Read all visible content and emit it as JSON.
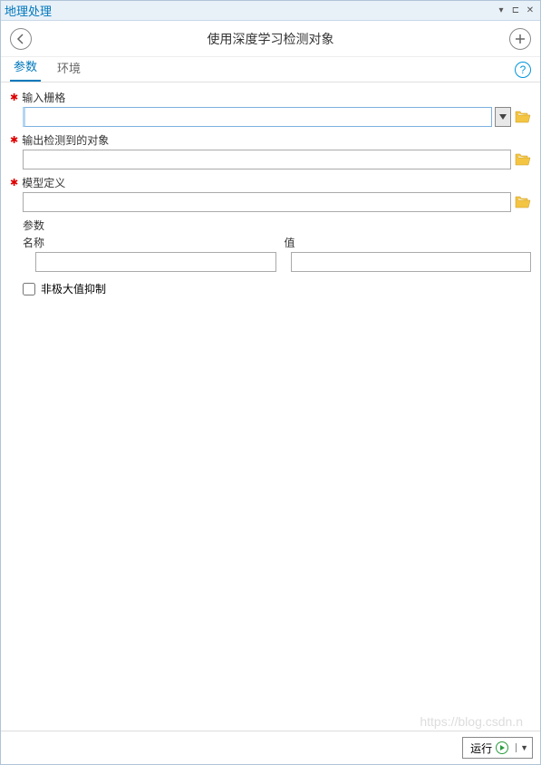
{
  "window": {
    "title": "地理处理"
  },
  "toolbar": {
    "title": "使用深度学习检测对象"
  },
  "tabs": {
    "params": "参数",
    "env": "环境"
  },
  "fields": {
    "input_raster": {
      "label": "输入栅格",
      "value": ""
    },
    "output_detected": {
      "label": "输出检测到的对象",
      "value": ""
    },
    "model_def": {
      "label": "模型定义",
      "value": ""
    }
  },
  "param_table": {
    "header": "参数",
    "col_name": "名称",
    "col_value": "值",
    "name_val": "",
    "value_val": ""
  },
  "nms": {
    "label": "非极大值抑制",
    "checked": false
  },
  "footer": {
    "run": "运行"
  },
  "watermark": "https://blog.csdn.n"
}
